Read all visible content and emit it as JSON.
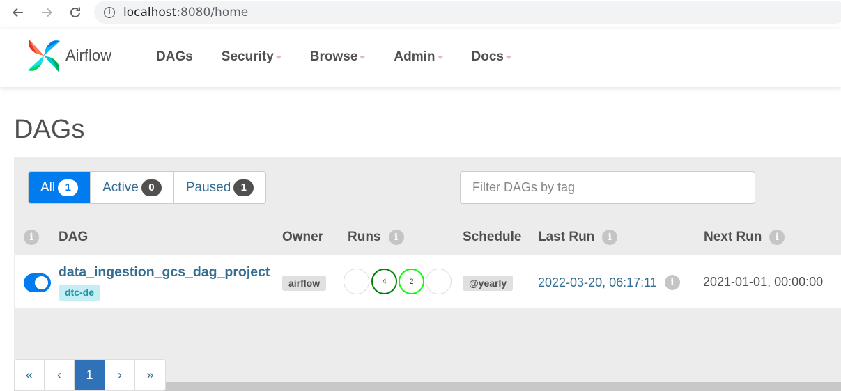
{
  "browser": {
    "host": "localhost",
    "path": ":8080/home"
  },
  "navbar": {
    "brand": "Airflow",
    "items": [
      {
        "label": "DAGs",
        "has_caret": false
      },
      {
        "label": "Security",
        "has_caret": true
      },
      {
        "label": "Browse",
        "has_caret": true
      },
      {
        "label": "Admin",
        "has_caret": true
      },
      {
        "label": "Docs",
        "has_caret": true
      }
    ]
  },
  "page": {
    "title": "DAGs"
  },
  "filters": {
    "all": {
      "label": "All",
      "count": "1"
    },
    "active": {
      "label": "Active",
      "count": "0"
    },
    "paused": {
      "label": "Paused",
      "count": "1"
    },
    "tag_placeholder": "Filter DAGs by tag"
  },
  "table": {
    "headers": {
      "dag": "DAG",
      "owner": "Owner",
      "runs": "Runs",
      "schedule": "Schedule",
      "last_run": "Last Run",
      "next_run": "Next Run"
    },
    "rows": [
      {
        "enabled": true,
        "dag_id": "data_ingestion_gcs_dag_project",
        "tags": [
          "dtc-de"
        ],
        "owner": "airflow",
        "runs": [
          {
            "state": "queued",
            "count": "",
            "color": "#dddddd"
          },
          {
            "state": "success",
            "count": "4",
            "color": "#008000"
          },
          {
            "state": "running",
            "count": "2",
            "color": "#00ff00"
          },
          {
            "state": "failed",
            "count": "",
            "color": "#dddddd"
          }
        ],
        "schedule": "@yearly",
        "last_run": "2022-03-20, 06:17:11",
        "next_run": "2021-01-01, 00:00:00"
      }
    ]
  },
  "pagination": {
    "first": "«",
    "prev": "‹",
    "current": "1",
    "next": "›",
    "last": "»"
  },
  "colors": {
    "accent": "#017cee",
    "link": "#336d91",
    "tag_bg": "#c4eef4",
    "pager_active": "#2f72b8"
  }
}
